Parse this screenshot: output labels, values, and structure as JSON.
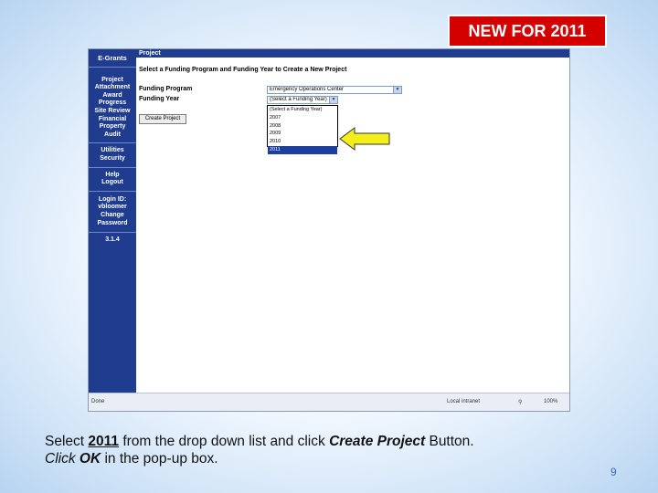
{
  "badge": "NEW FOR 2011",
  "sidebar": {
    "groups": [
      [
        "E-Grants"
      ],
      [
        "Project",
        "Attachment",
        "Award",
        "Progress",
        "Site Review",
        "Financial",
        "Property",
        "Audit"
      ],
      [
        "Utilities",
        "Security"
      ],
      [
        "Help",
        "Logout"
      ],
      [
        "Login ID:",
        "vbloomer",
        "Change",
        "Password"
      ],
      [
        "3.1.4"
      ]
    ]
  },
  "page": {
    "title": "Project",
    "heading": "Select a Funding Program and Funding Year to Create a New Project",
    "program_label": "Funding Program",
    "program_value": "Emergency Operations Center",
    "year_label": "Funding Year",
    "year_value": "(Select a Funding Year)",
    "create_button": "Create Project"
  },
  "dropdown": {
    "options": [
      "(Select a Funding Year)",
      "2007",
      "2008",
      "2009",
      "2010",
      "2011"
    ],
    "selected": "2011"
  },
  "statusbar": {
    "left": "Done",
    "zone": "Local intranet",
    "zoom": "100%"
  },
  "caption": {
    "line1_a": "Select ",
    "line1_year": "2011",
    "line1_b": " from the drop down list and click ",
    "line1_btn": "Create Project",
    "line1_c": " Button.",
    "line2_a": "Click ",
    "line2_ok": "OK",
    "line2_b": " in the pop-up box."
  },
  "page_number": "9",
  "colors": {
    "badge": "#d40000",
    "sidebar": "#1f3c8f",
    "arrow": "#f4ef1a"
  }
}
